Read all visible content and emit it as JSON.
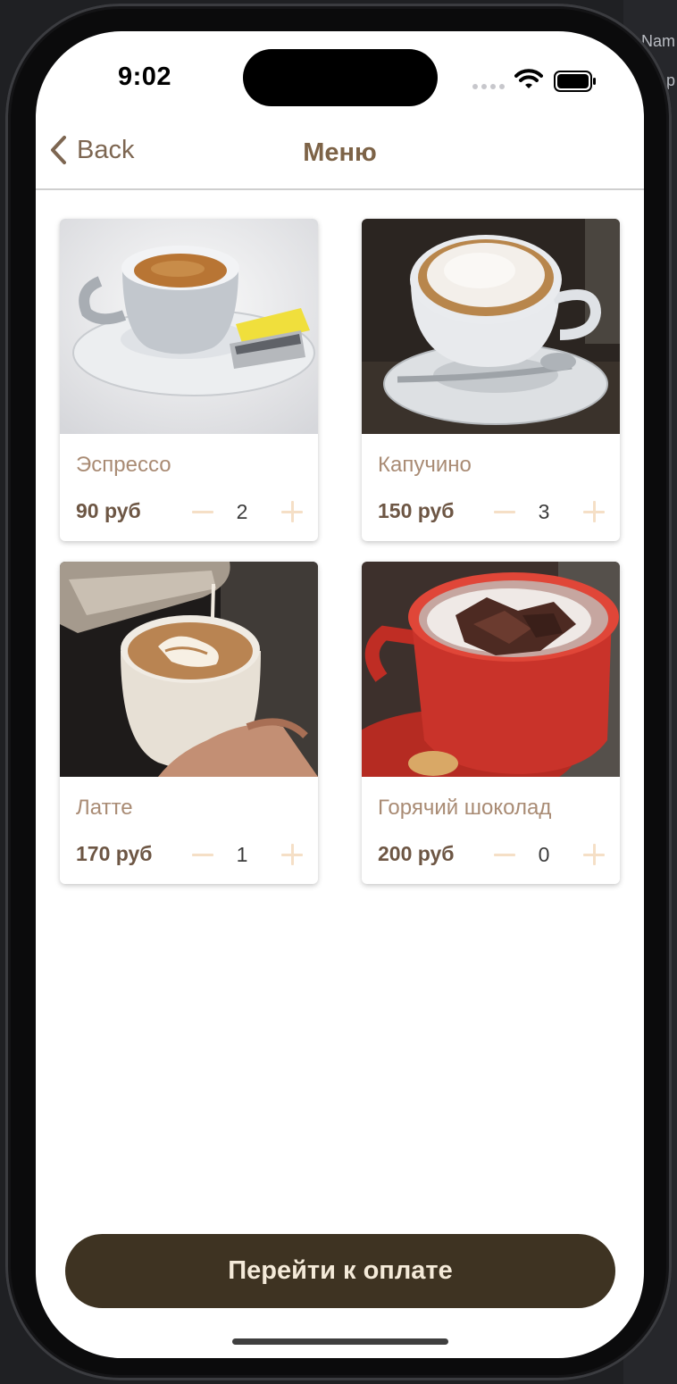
{
  "background": {
    "right_text_1": "Nam",
    "right_text_2": "p"
  },
  "status_bar": {
    "time": "9:02"
  },
  "nav": {
    "back_label": "Back",
    "title": "Меню"
  },
  "menu": {
    "items": [
      {
        "name": "Эспрессо",
        "price": "90 руб",
        "quantity": "2",
        "image": "espresso-cup-photo"
      },
      {
        "name": "Капучино",
        "price": "150 руб",
        "quantity": "3",
        "image": "cappuccino-cup-photo"
      },
      {
        "name": "Латте",
        "price": "170 руб",
        "quantity": "1",
        "image": "latte-art-photo"
      },
      {
        "name": "Горячий шоколад",
        "price": "200 руб",
        "quantity": "0",
        "image": "hot-chocolate-cup-photo"
      }
    ]
  },
  "checkout": {
    "button_label": "Перейти к оплате"
  },
  "colors": {
    "title": "#7d6347",
    "item_name": "#a98b74",
    "price": "#6d5644",
    "stepper": "#f5dfc6",
    "button_bg": "#3e3322",
    "button_text": "#f4ead9"
  }
}
